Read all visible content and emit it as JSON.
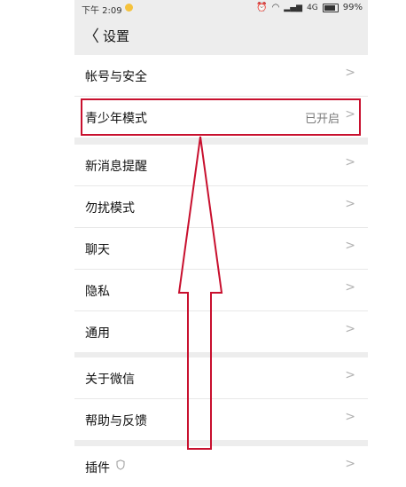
{
  "status_bar": {
    "time": "下午 2:09",
    "network": "4G",
    "battery": "99%"
  },
  "header": {
    "title": "设置"
  },
  "groups": [
    {
      "items": [
        {
          "label": "帐号与安全"
        },
        {
          "label": "青少年模式",
          "value": "已开启"
        }
      ]
    },
    {
      "items": [
        {
          "label": "新消息提醒"
        },
        {
          "label": "勿扰模式"
        },
        {
          "label": "聊天"
        },
        {
          "label": "隐私"
        },
        {
          "label": "通用"
        }
      ]
    },
    {
      "items": [
        {
          "label": "关于微信"
        },
        {
          "label": "帮助与反馈"
        }
      ]
    },
    {
      "items": [
        {
          "label": "插件"
        }
      ]
    }
  ],
  "colors": {
    "highlight": "#c8102e",
    "background": "#ededed"
  }
}
